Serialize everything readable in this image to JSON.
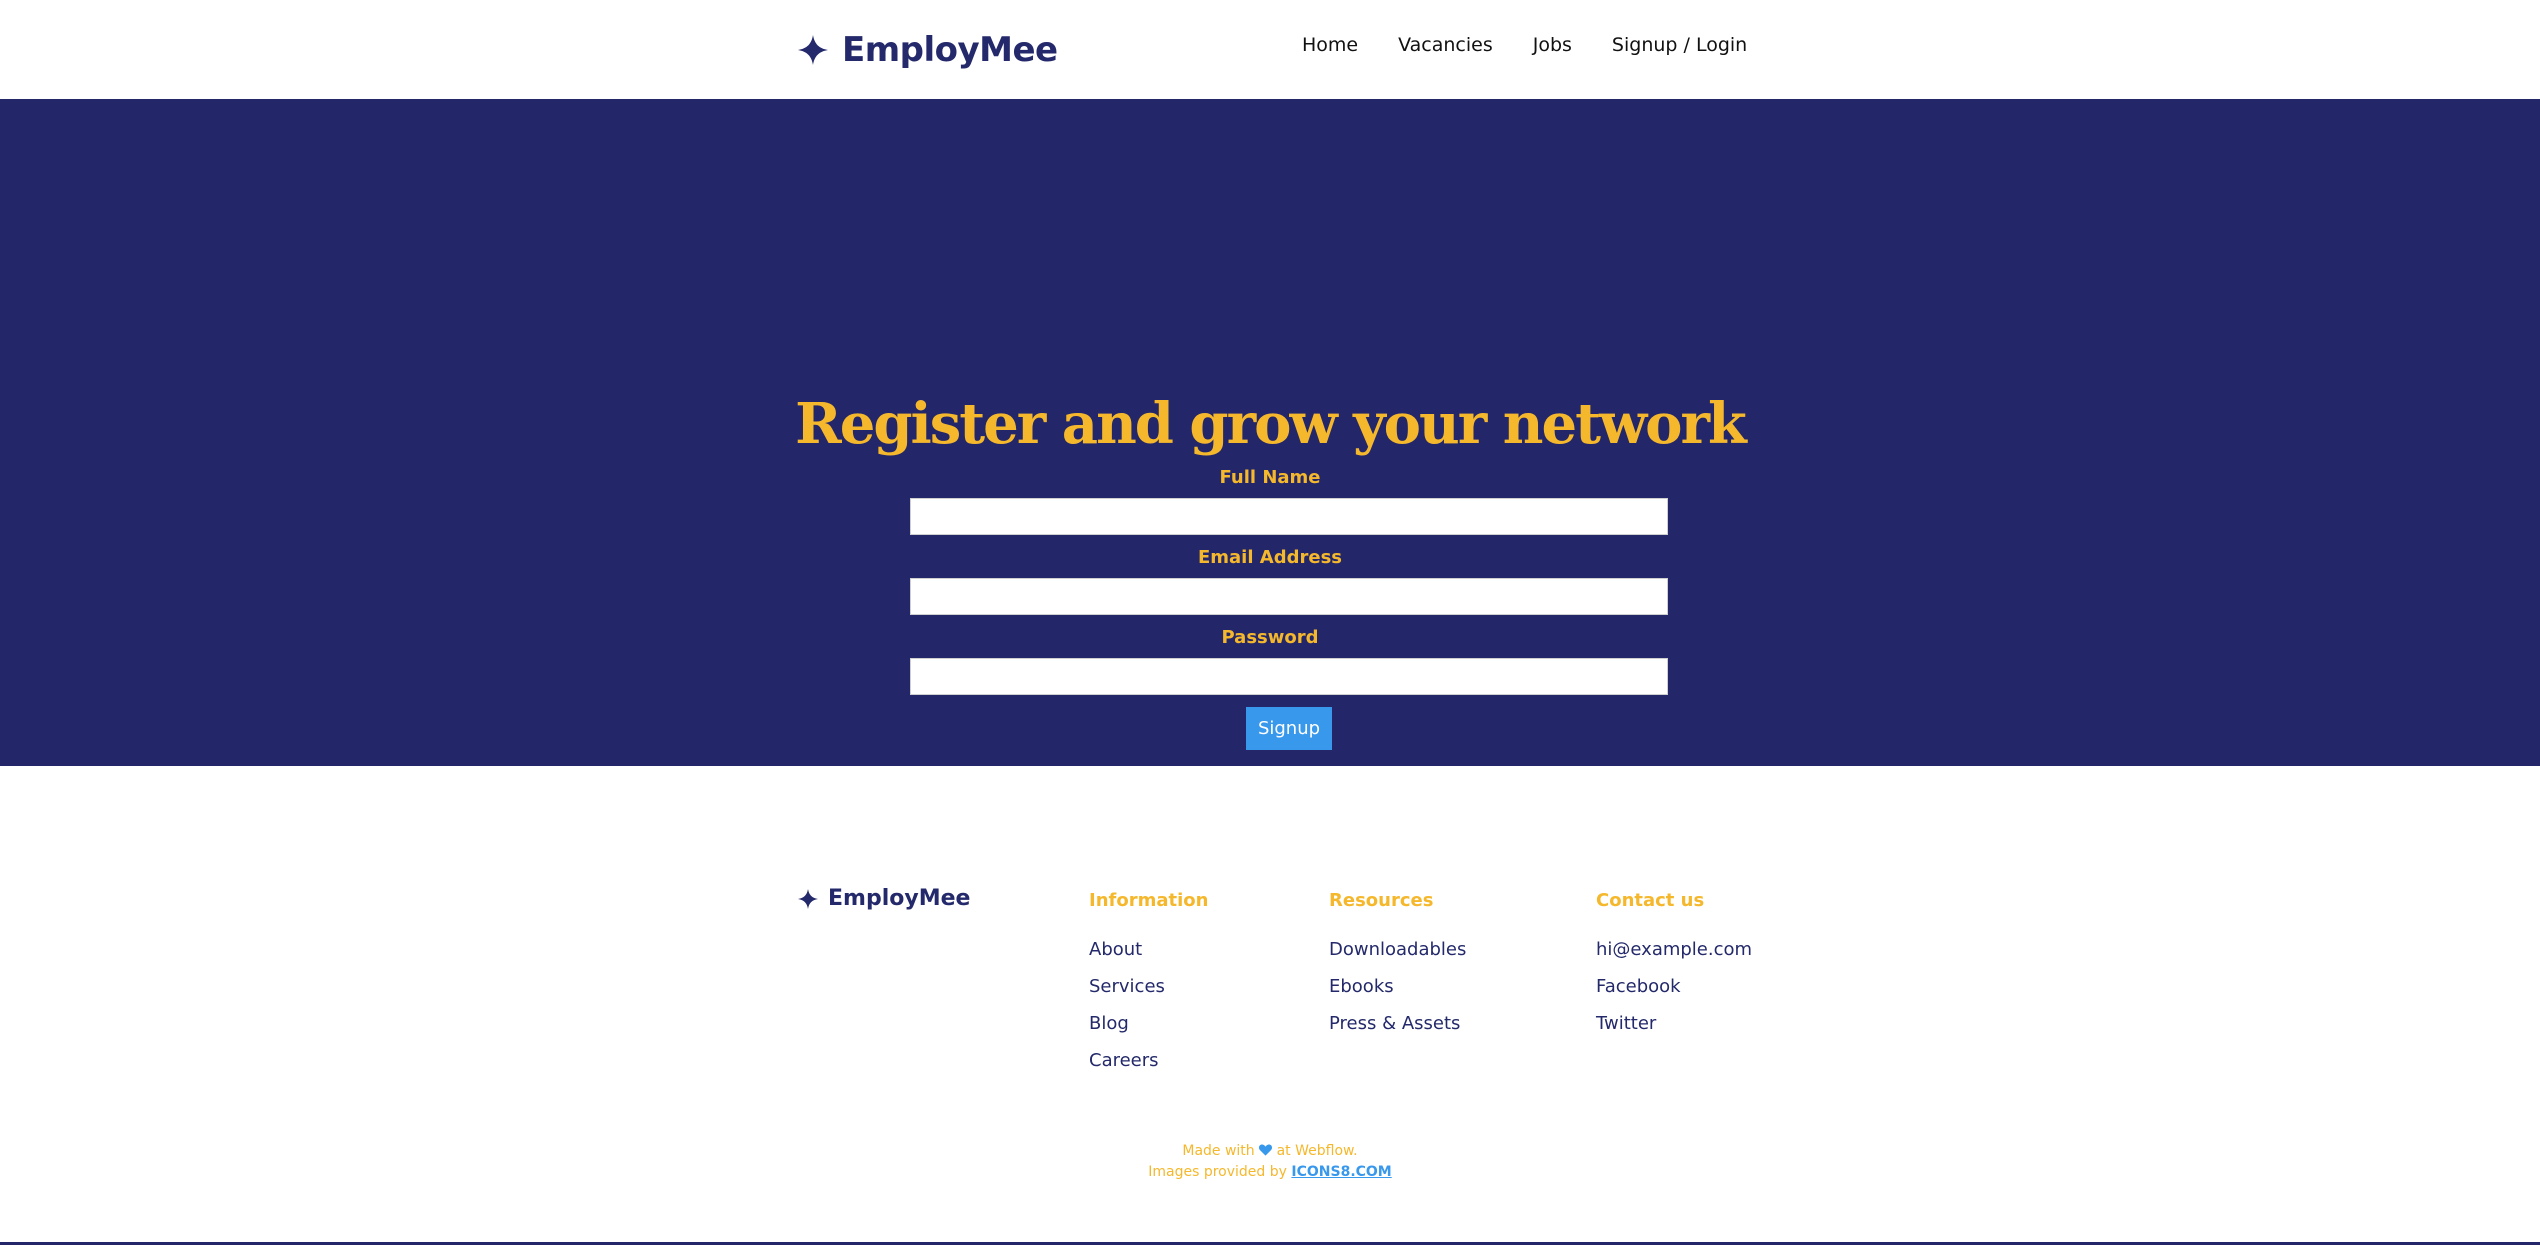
{
  "colors": {
    "brand": "#23296a",
    "hero_background": "#23276a",
    "accent": "#f5b82d",
    "button": "#3898ec"
  },
  "nav": {
    "brand_icon": "star-icon",
    "brand_name": "EmployMee",
    "links": {
      "home": "Home",
      "vacancies": "Vacancies",
      "jobs": "Jobs",
      "signup_login": "Signup / Login"
    }
  },
  "hero": {
    "title": "Register and grow your network",
    "form": {
      "full_name_label": "Full Name",
      "full_name_value": "",
      "email_label": "Email Address",
      "email_value": "",
      "password_label": "Password",
      "password_value": "",
      "submit_label": "Signup"
    }
  },
  "footer": {
    "brand_name": "EmployMee",
    "columns": {
      "information": {
        "heading": "Information",
        "links": [
          "About",
          "Services",
          "Blog",
          "Careers"
        ]
      },
      "resources": {
        "heading": "Resources",
        "links": [
          "Downloadables",
          "Ebooks",
          "Press & Assets"
        ]
      },
      "contact": {
        "heading": "Contact us",
        "links": [
          "hi@example.com",
          "Facebook",
          "Twitter"
        ]
      }
    },
    "credits": {
      "made_with_prefix": "Made with",
      "heart_icon": "heart-icon",
      "made_with_suffix": "at Webflow.",
      "images_prefix": "Images provided by",
      "images_link": "ICONS8.COM"
    }
  }
}
